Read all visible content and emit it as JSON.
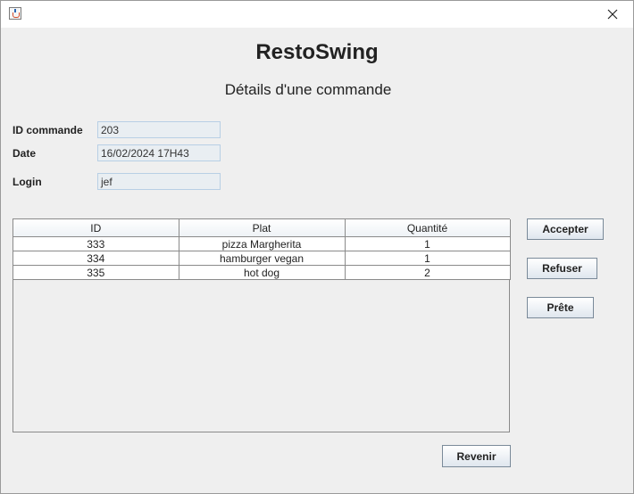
{
  "app": {
    "icon": "java-cup-icon"
  },
  "header": {
    "title": "RestoSwing",
    "subtitle": "Détails d'une commande"
  },
  "form": {
    "id_label": "ID commande",
    "id_value": "203",
    "date_label": "Date",
    "date_value": "16/02/2024 17H43",
    "login_label": "Login",
    "login_value": "jef"
  },
  "table": {
    "columns": [
      "ID",
      "Plat",
      "Quantité"
    ],
    "rows": [
      [
        "333",
        "pizza Margherita",
        "1"
      ],
      [
        "334",
        "hamburger vegan",
        "1"
      ],
      [
        "335",
        "hot dog",
        "2"
      ]
    ]
  },
  "actions": {
    "accept": "Accepter",
    "refuse": "Refuser",
    "ready": "Prête",
    "back": "Revenir"
  }
}
